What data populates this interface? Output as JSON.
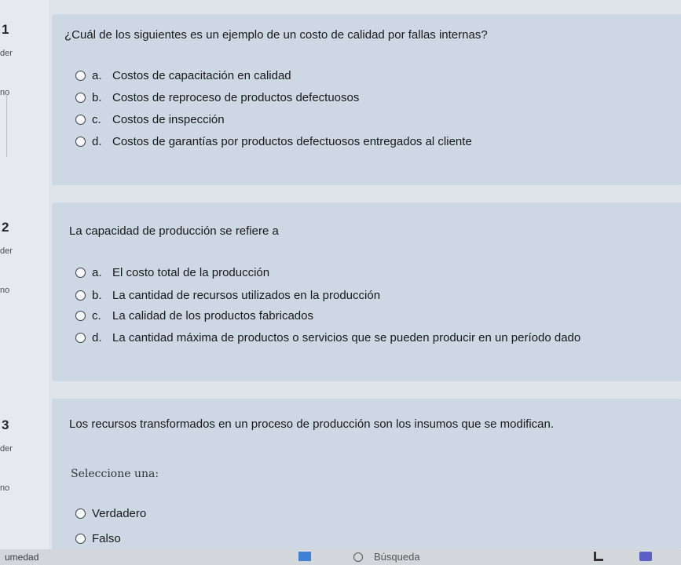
{
  "sidebar": {
    "q1": {
      "number": "1",
      "state": "der",
      "mark": "no"
    },
    "q2": {
      "number": "2",
      "state": "der",
      "mark": "no"
    },
    "q3": {
      "number": "3",
      "state": "der",
      "mark": "no"
    }
  },
  "question1": {
    "text": "¿Cuál de los siguientes es un ejemplo de un costo de calidad por fallas internas?",
    "options": [
      {
        "letter": "a.",
        "text": "Costos de capacitación en calidad"
      },
      {
        "letter": "b.",
        "text": "Costos de reproceso de productos defectuosos"
      },
      {
        "letter": "c.",
        "text": "Costos de inspección"
      },
      {
        "letter": "d.",
        "text": "Costos de garantías por productos defectuosos entregados al cliente"
      }
    ]
  },
  "question2": {
    "text": "La capacidad de producción se refiere a",
    "options": [
      {
        "letter": "a.",
        "text": "El costo total de la producción"
      },
      {
        "letter": "b.",
        "text": "La cantidad de recursos utilizados en la producción"
      },
      {
        "letter": "c.",
        "text": "La calidad de los productos fabricados"
      },
      {
        "letter": "d.",
        "text": "La cantidad máxima de productos o servicios que se pueden producir en un período dado"
      }
    ]
  },
  "question3": {
    "text": "Los recursos transformados en un proceso de producción son los insumos que se modifican.",
    "prompt": "Seleccione una:",
    "options": [
      {
        "text": "Verdadero"
      },
      {
        "text": "Falso"
      }
    ]
  },
  "taskbar": {
    "weather": "umedad",
    "search": "Búsqueda"
  },
  "colors": {
    "card": "#cdd8e4",
    "background": "#dfe4ea",
    "taskbar": "#d3d7dc"
  }
}
